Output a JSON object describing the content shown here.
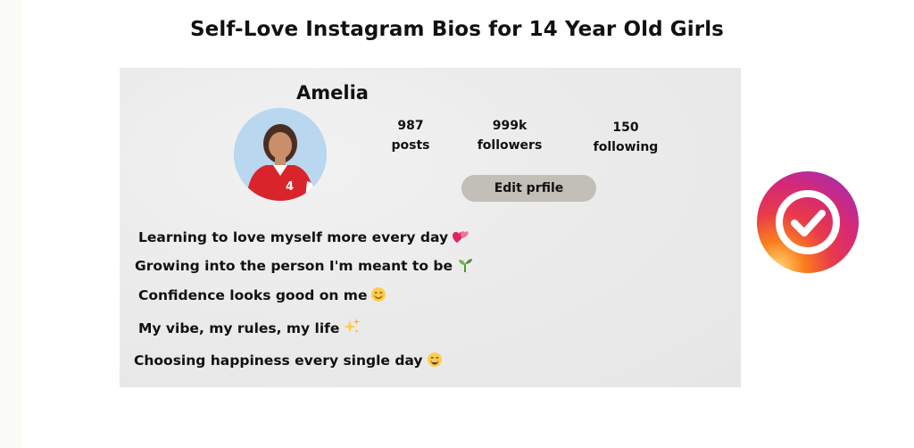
{
  "page": {
    "title": "Self-Love Instagram Bios for 14 Year Old Girls"
  },
  "profile": {
    "username": "Amelia",
    "stats": [
      {
        "value": "987",
        "label": "posts"
      },
      {
        "value": "999k",
        "label": "followers"
      },
      {
        "value": "150",
        "label": "following"
      }
    ],
    "edit_button_label": "Edit prfile"
  },
  "bios": [
    {
      "text": "Learning to love myself more every day",
      "icon": "two-hearts-icon"
    },
    {
      "text": "Growing into the person I'm meant to be",
      "icon": "seedling-icon"
    },
    {
      "text": "Confidence looks good on me",
      "icon": "smiling-face-icon"
    },
    {
      "text": "My vibe, my rules, my life",
      "icon": "sparkles-icon"
    },
    {
      "text": "Choosing happiness every single day",
      "icon": "grinning-face-icon"
    }
  ],
  "badge": {
    "icon": "instagram-check-badge-icon",
    "colors": [
      "#d62976",
      "#fa7e1e",
      "#962fbf",
      "#feda75"
    ]
  }
}
